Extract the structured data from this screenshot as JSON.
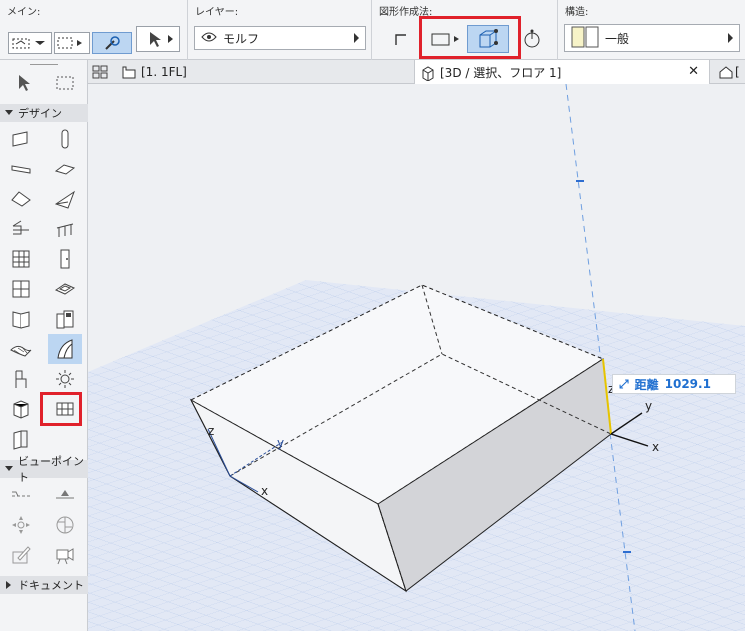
{
  "infobar": {
    "main_label": "メイン:",
    "layer_label": "レイヤー:",
    "layer_value": "モルフ",
    "method_label": "図形作成法:",
    "structure_label": "構造:",
    "structure_value": "一般"
  },
  "toolbox": {
    "sections": [
      {
        "label": "デザイン",
        "expanded": true
      },
      {
        "label": "ビューポイント",
        "expanded": true
      },
      {
        "label": "ドキュメント",
        "expanded": false
      }
    ]
  },
  "tabs": [
    {
      "label": "[1. 1FL]"
    },
    {
      "label": "[3D / 選択、フロア 1]",
      "active": true
    }
  ],
  "viewport": {
    "distance_label": "距離",
    "distance_value": "1029.1",
    "axis_labels": {
      "x": "x",
      "y": "y",
      "z": "z"
    }
  },
  "colors": {
    "highlight_red": "#e0212b",
    "selected_blue": "#bcd6f2",
    "grid_blue": "#9db7e2",
    "accent_text": "#1f6fd0"
  }
}
